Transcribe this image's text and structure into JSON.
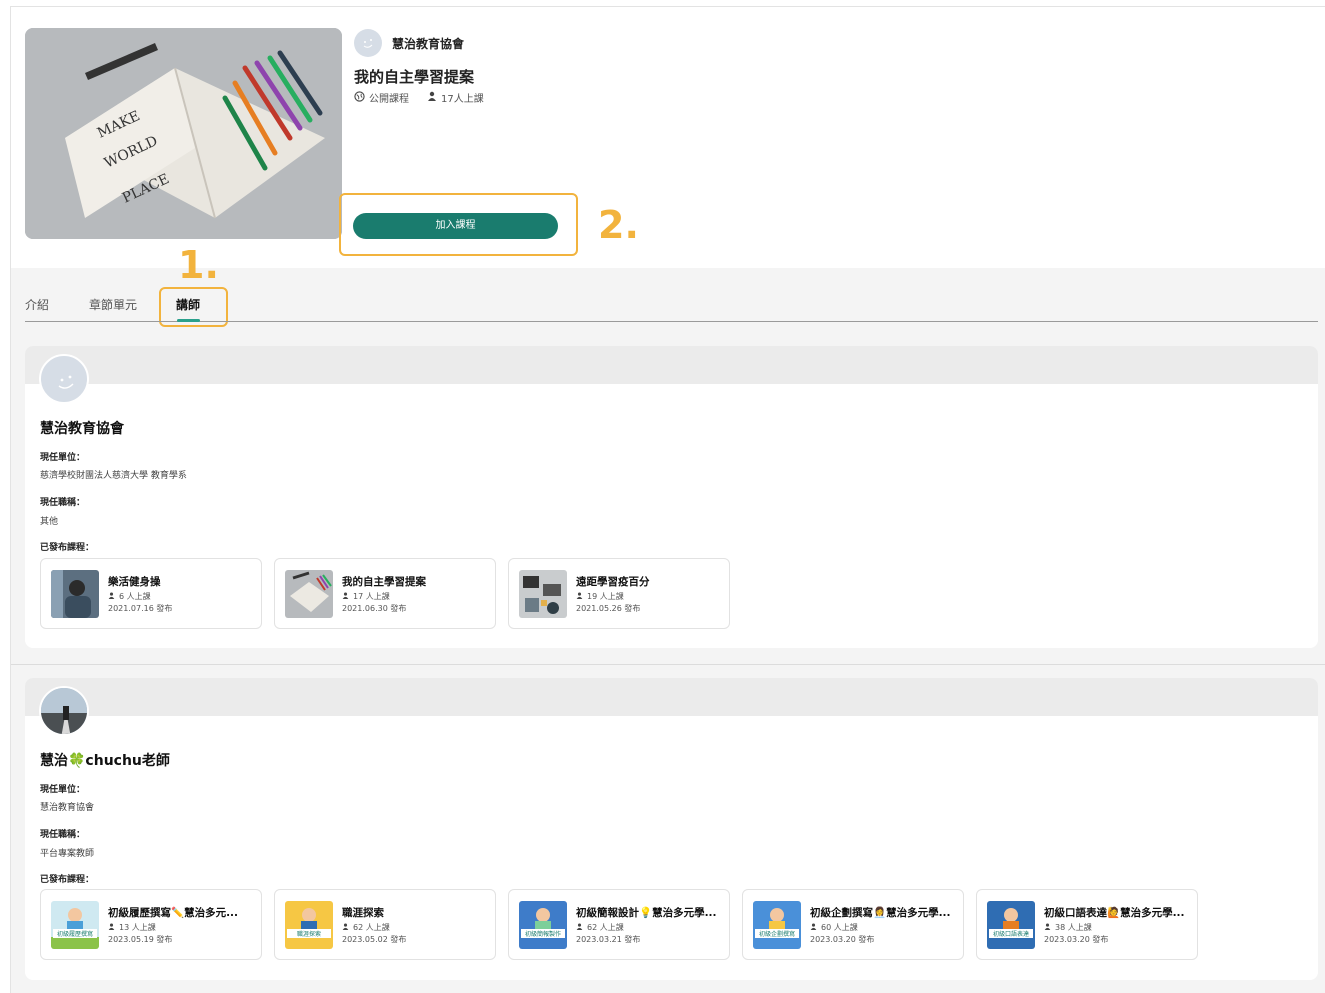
{
  "header": {
    "org_name": "慧治教育協會",
    "course_title": "我的自主學習提案",
    "visibility": "公開課程",
    "students": "17人上課",
    "join_button": "加入課程"
  },
  "annotations": {
    "step1": "1.",
    "step2": "2."
  },
  "tabs": [
    {
      "label": "介紹",
      "active": false
    },
    {
      "label": "章節單元",
      "active": false
    },
    {
      "label": "講師",
      "active": true
    }
  ],
  "teachers": [
    {
      "name": "慧治教育協會",
      "unit_label": "現任單位：",
      "unit": "慈濟學校財團法人慈濟大學 教育學系",
      "title_label": "現任職稱：",
      "title": "其他",
      "courses_label": "已發布課程：",
      "courses": [
        {
          "title": "樂活健身操",
          "students": "6 人上課",
          "date": "2021.07.16 發布"
        },
        {
          "title": "我的自主學習提案",
          "students": "17 人上課",
          "date": "2021.06.30 發布"
        },
        {
          "title": "遠距學習疫百分",
          "students": "19 人上課",
          "date": "2021.05.26 發布"
        }
      ]
    },
    {
      "name": "慧治🍀chuchu老師",
      "unit_label": "現任單位：",
      "unit": "慧治教育協會",
      "title_label": "現任職稱：",
      "title": "平台專案教師",
      "courses_label": "已發布課程：",
      "courses": [
        {
          "title": "初級履歷撰寫✏️慧治多元...",
          "students": "13 人上課",
          "date": "2023.05.19 發布",
          "thumb_text": "初級履歷撰寫"
        },
        {
          "title": "職涯探索",
          "students": "62 人上課",
          "date": "2023.05.02 發布",
          "thumb_text": "職涯探索"
        },
        {
          "title": "初級簡報設計💡慧治多元學...",
          "students": "62 人上課",
          "date": "2023.03.21 發布",
          "thumb_text": "初級簡報製作"
        },
        {
          "title": "初級企劃撰寫👩‍💼慧治多元學...",
          "students": "60 人上課",
          "date": "2023.03.20 發布",
          "thumb_text": "初級企劃撰寫"
        },
        {
          "title": "初級口語表達🙋慧治多元學...",
          "students": "38 人上課",
          "date": "2023.03.20 發布",
          "thumb_text": "初級口語表達"
        }
      ]
    }
  ],
  "icons": {
    "globe": "globe-icon",
    "person": "person-icon"
  },
  "colors": {
    "accent": "#1a7c6e",
    "highlight": "#f2b33d",
    "tab_underline": "#2aa08c"
  }
}
